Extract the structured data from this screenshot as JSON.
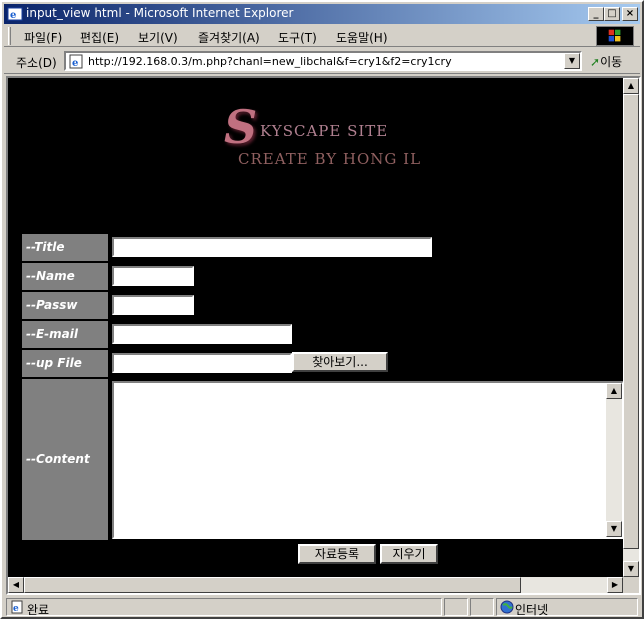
{
  "window": {
    "title": "input_view html - Microsoft Internet Explorer",
    "controls": {
      "minimize": "_",
      "maximize": "□",
      "close": "×"
    }
  },
  "menu": [
    "파일(F)",
    "편집(E)",
    "보기(V)",
    "즐겨찾기(A)",
    "도구(T)",
    "도움말(H)"
  ],
  "address": {
    "label": "주소(D)",
    "url": "http://192.168.0.3/m.php?chanl=new_libchal&f=cry1&f2=cry1cry",
    "go_label": "이동"
  },
  "logo": {
    "big_letter": "S",
    "line1": "KYSCAPE SITE",
    "line2": "CREATE BY HONG IL"
  },
  "form": {
    "title_label": "--Title",
    "name_label": "--Name",
    "password_label": "--Passw",
    "email_label": "--E-mail",
    "file_label": "--up File",
    "content_label": "--Content",
    "title_value": "",
    "name_value": "",
    "password_value": "",
    "email_value": "",
    "file_value": "",
    "browse_button": "찾아보기...",
    "submit_button": "자료등록",
    "reset_button": "지우기"
  },
  "status": {
    "text": "완료",
    "zone": "인터넷"
  },
  "icons": {
    "app": "ie-icon",
    "page": "page-icon",
    "go": "go-arrow-icon",
    "status": "page-status-icon",
    "zone": "globe-icon",
    "windows_logo": "windows-logo-icon"
  }
}
